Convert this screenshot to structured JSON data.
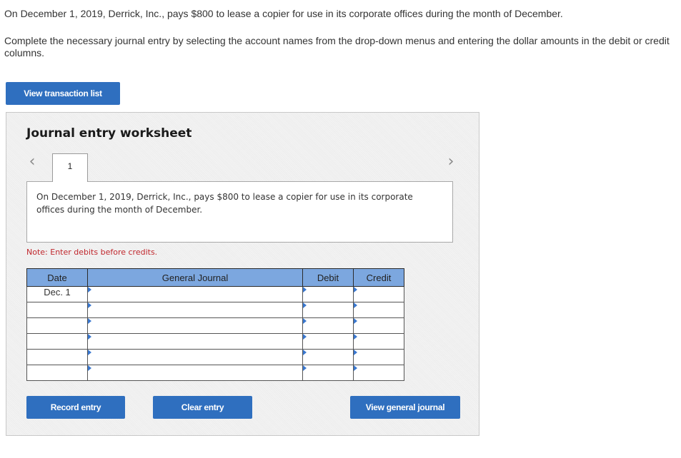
{
  "question": {
    "text": "On December 1, 2019, Derrick, Inc., pays $800 to lease a copier for use in its corporate offices during the month of December.",
    "instructions": "Complete the necessary journal entry by selecting the account names from the drop-down menus and entering the dollar amounts in the debit or credit columns."
  },
  "buttons": {
    "view_transaction_list": "View transaction list",
    "record_entry": "Record entry",
    "clear_entry": "Clear entry",
    "view_general_journal": "View general journal"
  },
  "worksheet": {
    "title": "Journal entry worksheet",
    "prev_icon": "‹",
    "next_icon": "›",
    "tabs": [
      {
        "label": "1",
        "active": true
      }
    ],
    "transaction_description": "On December 1, 2019, Derrick, Inc., pays $800 to lease a copier for use in its corporate offices during the month of December.",
    "note": "Note: Enter debits before credits.",
    "table": {
      "headers": {
        "date": "Date",
        "general_journal": "General Journal",
        "debit": "Debit",
        "credit": "Credit"
      },
      "rows": [
        {
          "date": "Dec. 1",
          "account": "",
          "debit": "",
          "credit": ""
        },
        {
          "date": "",
          "account": "",
          "debit": "",
          "credit": ""
        },
        {
          "date": "",
          "account": "",
          "debit": "",
          "credit": ""
        },
        {
          "date": "",
          "account": "",
          "debit": "",
          "credit": ""
        },
        {
          "date": "",
          "account": "",
          "debit": "",
          "credit": ""
        },
        {
          "date": "",
          "account": "",
          "debit": "",
          "credit": ""
        }
      ]
    }
  },
  "colors": {
    "button_blue": "#2f6fbf",
    "header_blue": "#7ca7df",
    "note_red": "#c0272d",
    "field_border": "#3a6aa6"
  }
}
